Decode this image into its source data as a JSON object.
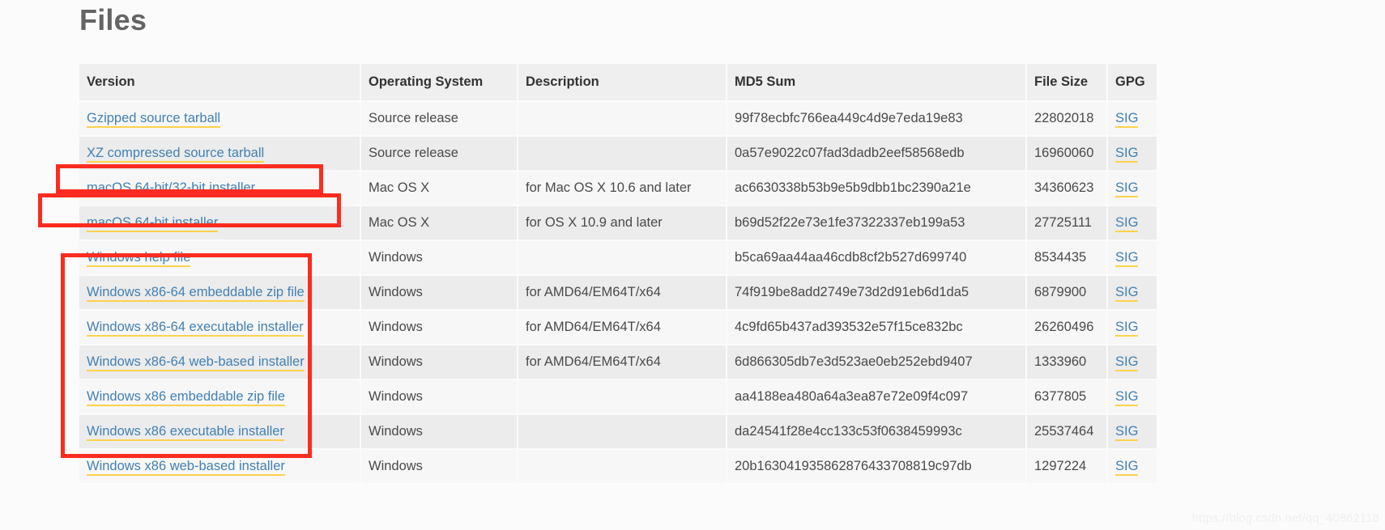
{
  "page": {
    "title": "Files",
    "watermark": "https://blog.csdn.net/qq_40862118"
  },
  "table": {
    "columns": [
      {
        "key": "version",
        "label": "Version"
      },
      {
        "key": "os",
        "label": "Operating System"
      },
      {
        "key": "description",
        "label": "Description"
      },
      {
        "key": "md5",
        "label": "MD5 Sum"
      },
      {
        "key": "size",
        "label": "File Size"
      },
      {
        "key": "gpg",
        "label": "GPG"
      }
    ],
    "rows": [
      {
        "version": "Gzipped source tarball",
        "os": "Source release",
        "description": "",
        "md5": "99f78ecbfc766ea449c4d9e7eda19e83",
        "size": "22802018",
        "gpg": "SIG"
      },
      {
        "version": "XZ compressed source tarball",
        "os": "Source release",
        "description": "",
        "md5": "0a57e9022c07fad3dadb2eef58568edb",
        "size": "16960060",
        "gpg": "SIG"
      },
      {
        "version": "macOS 64-bit/32-bit installer",
        "os": "Mac OS X",
        "description": "for Mac OS X 10.6 and later",
        "md5": "ac6630338b53b9e5b9dbb1bc2390a21e",
        "size": "34360623",
        "gpg": "SIG"
      },
      {
        "version": "macOS 64-bit installer",
        "os": "Mac OS X",
        "description": "for OS X 10.9 and later",
        "md5": "b69d52f22e73e1fe37322337eb199a53",
        "size": "27725111",
        "gpg": "SIG"
      },
      {
        "version": "Windows help file",
        "os": "Windows",
        "description": "",
        "md5": "b5ca69aa44aa46cdb8cf2b527d699740",
        "size": "8534435",
        "gpg": "SIG"
      },
      {
        "version": "Windows x86-64 embeddable zip file",
        "os": "Windows",
        "description": "for AMD64/EM64T/x64",
        "md5": "74f919be8add2749e73d2d91eb6d1da5",
        "size": "6879900",
        "gpg": "SIG"
      },
      {
        "version": "Windows x86-64 executable installer",
        "os": "Windows",
        "description": "for AMD64/EM64T/x64",
        "md5": "4c9fd65b437ad393532e57f15ce832bc",
        "size": "26260496",
        "gpg": "SIG"
      },
      {
        "version": "Windows x86-64 web-based installer",
        "os": "Windows",
        "description": "for AMD64/EM64T/x64",
        "md5": "6d866305db7e3d523ae0eb252ebd9407",
        "size": "1333960",
        "gpg": "SIG"
      },
      {
        "version": "Windows x86 embeddable zip file",
        "os": "Windows",
        "description": "",
        "md5": "aa4188ea480a64a3ea87e72e09f4c097",
        "size": "6377805",
        "gpg": "SIG"
      },
      {
        "version": "Windows x86 executable installer",
        "os": "Windows",
        "description": "",
        "md5": "da24541f28e4cc133c53f0638459993c",
        "size": "25537464",
        "gpg": "SIG"
      },
      {
        "version": "Windows x86 web-based installer",
        "os": "Windows",
        "description": "",
        "md5": "20b163041935862876433708819c97db",
        "size": "1297224",
        "gpg": "SIG"
      }
    ]
  },
  "annotations": {
    "color": "#fc2c20",
    "boxes": [
      {
        "name": "macos-6432-installer-highlight"
      },
      {
        "name": "macos-64-installer-highlight"
      },
      {
        "name": "windows-installers-highlight"
      }
    ]
  },
  "theme": {
    "link_color": "#4280b4",
    "link_underline_color": "#ffd24d",
    "header_bg": "#efefef",
    "row_bg_odd": "#f7f7f7",
    "row_bg_even": "#ececec",
    "page_bg": "#fbfbfb",
    "title_color": "#646464"
  }
}
